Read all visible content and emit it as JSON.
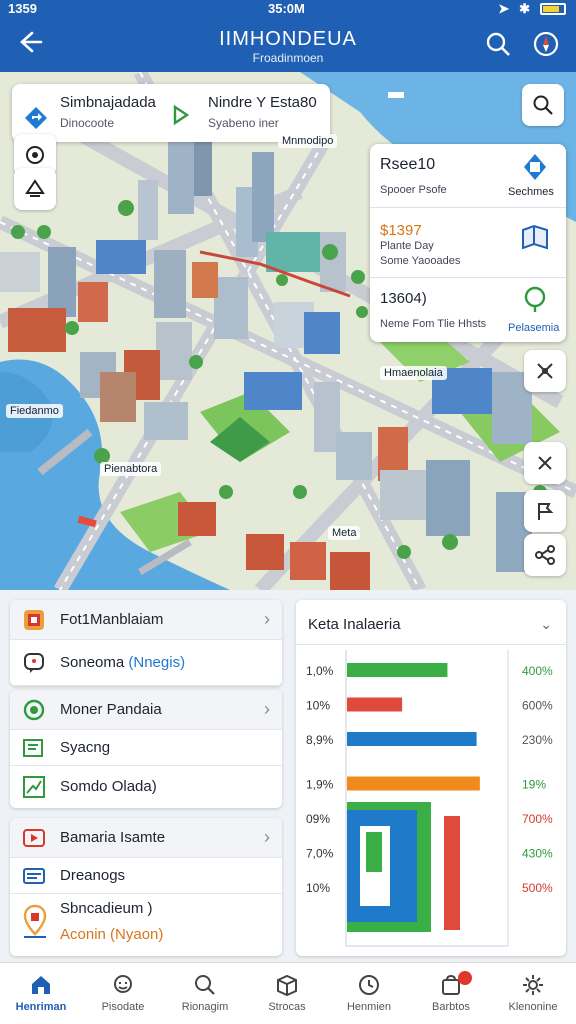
{
  "status_bar": {
    "time_left": "1359",
    "time_center": "35:0M"
  },
  "header": {
    "title": "IIMHONDEUA",
    "subtitle": "Froadinmoen"
  },
  "search_card": {
    "primary": {
      "title": "Simbnajadada",
      "subtitle": "Dinocoote"
    },
    "secondary": {
      "title": "Nindre Y Esta80",
      "subtitle": "Syabeno iner"
    }
  },
  "map_labels": [
    "Mnmodipo",
    "Hmaenolaia",
    "Fiedanmo",
    "Pienabtora",
    "Meta"
  ],
  "info_card": {
    "rows": [
      {
        "title": "Rsee10",
        "small": "Spooer Psofe",
        "right_label": "Sechmes"
      },
      {
        "title": "$1397",
        "small1": "Plante  Day",
        "small2": "Some  Yaooades",
        "right_label": ""
      },
      {
        "title": "13604)",
        "small": "Neme  Fom  Tlie  Hhsts",
        "right_label": "Pelasemia"
      }
    ]
  },
  "list_groups": [
    {
      "header": "Fot1Manblaiam",
      "items": [
        {
          "text_prefix": "Soneoma ",
          "text_highlight": "(Nnegis)"
        }
      ]
    },
    {
      "header": "Moner Pandaia",
      "items": [
        {
          "text": "Syacng"
        },
        {
          "text": "Somdo Olada)"
        }
      ]
    },
    {
      "header": "Bamaria Isamte",
      "items": [
        {
          "text": "Dreanogs"
        },
        {
          "text": "Sbncadieum )"
        },
        {
          "text": "Aconin (Nyaon)"
        }
      ]
    }
  ],
  "chart_data": {
    "type": "bar",
    "title": "Keta Inalaeria",
    "rows": [
      {
        "left_label": "1,0%",
        "right_label": "400%",
        "color": "#3aaf46",
        "value": 0.62
      },
      {
        "left_label": "10%",
        "right_label": "600%",
        "color": "#e04a3c",
        "value": 0.34
      },
      {
        "left_label": "8,9%",
        "right_label": "230%",
        "color": "#1f7ac9",
        "value": 0.8
      },
      {
        "left_label": "1,9%",
        "right_label": "19%",
        "color": "#f08a1c",
        "value": 0.82
      },
      {
        "left_label": "09%",
        "right_label": "700%",
        "color": "",
        "value": null
      },
      {
        "left_label": "7,0%",
        "right_label": "430%",
        "color": "",
        "value": null
      },
      {
        "left_label": "10%",
        "right_label": "500%",
        "color": "",
        "value": null
      }
    ],
    "right_label_colors": [
      "#2e9a3e",
      "#555555",
      "#555555",
      "#2e9a3e",
      "#d23b2e",
      "#2e9a3e",
      "#d23b2e"
    ]
  },
  "bottom_nav": {
    "items": [
      {
        "label": "Henriman",
        "icon": "home-icon",
        "active": true
      },
      {
        "label": "Pisodate",
        "icon": "chat-icon"
      },
      {
        "label": "Rionagim",
        "icon": "search-icon"
      },
      {
        "label": "Strocas",
        "icon": "box-icon"
      },
      {
        "label": "Henmien",
        "icon": "clock-icon"
      },
      {
        "label": "Barbtos",
        "icon": "bag-icon"
      },
      {
        "label": "Klenonine",
        "icon": "gear-icon"
      }
    ]
  },
  "colors": {
    "header": "#1f5fb4",
    "accent": "#1f7ad1"
  }
}
